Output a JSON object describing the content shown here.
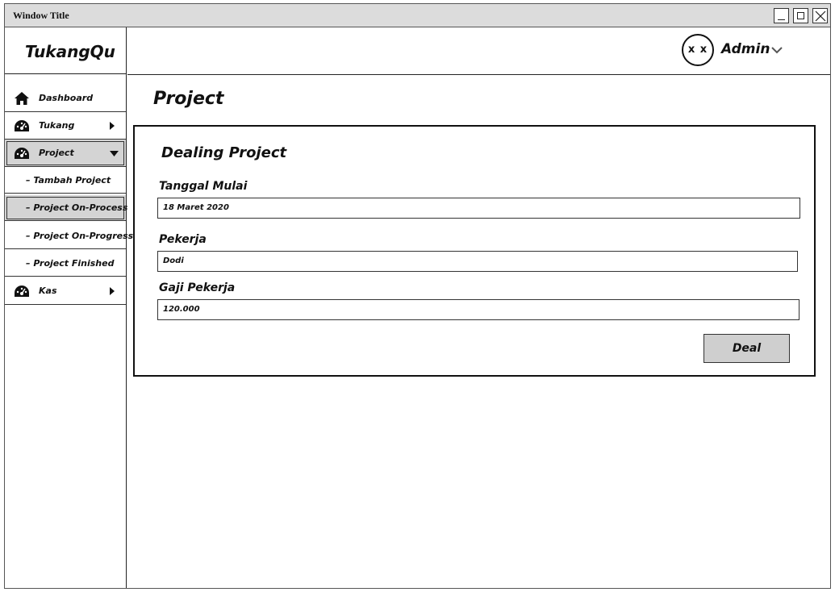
{
  "window": {
    "title": "Window Title"
  },
  "sidebar": {
    "brand": "TukangQu",
    "items": [
      {
        "label": "Dashboard",
        "icon": "home-icon"
      },
      {
        "label": "Tukang",
        "icon": "dashboard-gauge-icon",
        "arrow": "right"
      },
      {
        "label": "Project",
        "icon": "dashboard-gauge-icon",
        "arrow": "down",
        "selected": true
      },
      {
        "label": "Kas",
        "icon": "dashboard-gauge-icon",
        "arrow": "right"
      }
    ],
    "project_submenu": [
      {
        "label": "– Tambah Project"
      },
      {
        "label": "– Project On-Process",
        "selected": true
      },
      {
        "label": "– Project On-Progress"
      },
      {
        "label": "– Project Finished"
      }
    ]
  },
  "header": {
    "avatar_text": "x x",
    "user": "Admin"
  },
  "page": {
    "title": "Project"
  },
  "card": {
    "title": "Dealing Project",
    "fields": [
      {
        "label": "Tanggal Mulai",
        "value": "18 Maret 2020"
      },
      {
        "label": "Pekerja",
        "value": "Dodi"
      },
      {
        "label": "Gaji Pekerja",
        "value": "120.000"
      }
    ],
    "button": "Deal"
  },
  "colors": {
    "selected_bg": "#d4d4d4",
    "button_bg": "#cfcfcf",
    "titlebar_bg": "#dcdcdc"
  }
}
